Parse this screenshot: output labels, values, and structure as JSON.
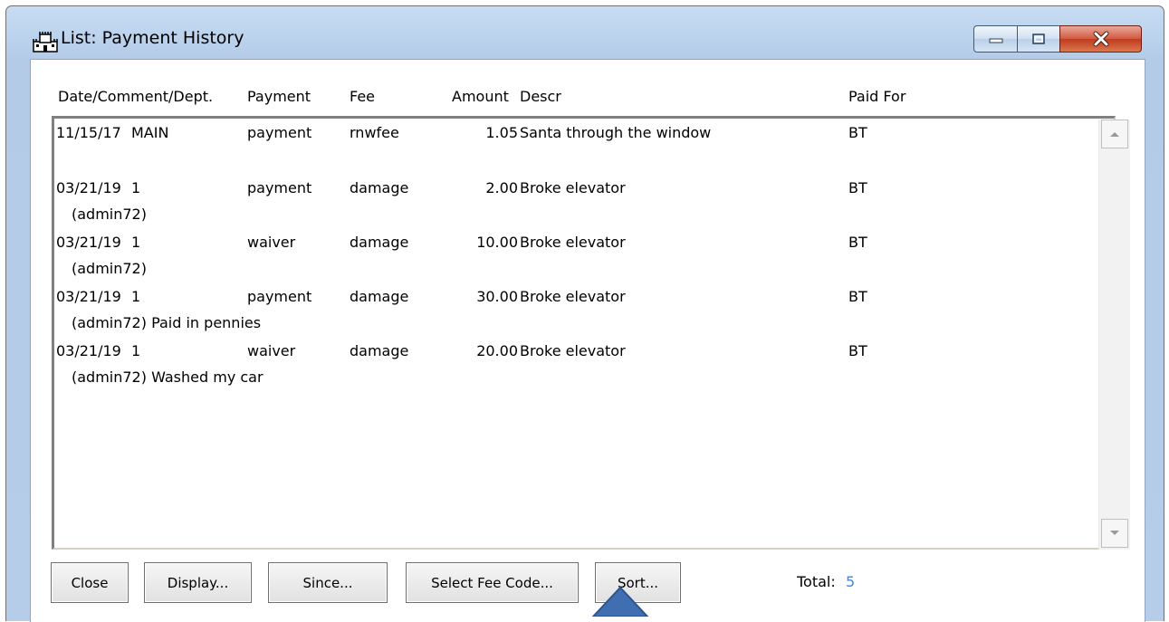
{
  "window": {
    "title": "List: Payment History",
    "app_icon": "castle-icon",
    "controls": {
      "minimize": "minimize-icon",
      "maximize": "maximize-icon",
      "close": "close-icon"
    }
  },
  "table": {
    "columns": [
      "Date/Comment/Dept.",
      "Payment",
      "Fee",
      "Amount",
      "Descr",
      "Paid For"
    ],
    "rows": [
      {
        "date": "11/15/17",
        "dept": "MAIN",
        "payment": "payment",
        "fee": "rnwfee",
        "amount": "1.05",
        "descr": "Santa through the window",
        "paid_for": "BT",
        "comment": ""
      },
      {
        "date": "03/21/19",
        "dept": "1",
        "payment": "payment",
        "fee": "damage",
        "amount": "2.00",
        "descr": "Broke elevator",
        "paid_for": "BT",
        "comment": "(admin72)"
      },
      {
        "date": "03/21/19",
        "dept": "1",
        "payment": "waiver",
        "fee": "damage",
        "amount": "10.00",
        "descr": "Broke elevator",
        "paid_for": "BT",
        "comment": "(admin72)"
      },
      {
        "date": "03/21/19",
        "dept": "1",
        "payment": "payment",
        "fee": "damage",
        "amount": "30.00",
        "descr": "Broke elevator",
        "paid_for": "BT",
        "comment": "(admin72) Paid in pennies"
      },
      {
        "date": "03/21/19",
        "dept": "1",
        "payment": "waiver",
        "fee": "damage",
        "amount": "20.00",
        "descr": "Broke elevator",
        "paid_for": "BT",
        "comment": "(admin72) Washed my car"
      }
    ]
  },
  "buttons": {
    "close": "Close",
    "display": "Display...",
    "since": "Since...",
    "select_fee_code": "Select Fee Code...",
    "sort": "Sort..."
  },
  "total": {
    "label": "Total:",
    "value": "5"
  },
  "colors": {
    "title_bar": "#bfd3ec",
    "close_button": "#c8462a",
    "total_value": "#3a8ad8",
    "pointer_arrow": "#3f6fb0"
  }
}
